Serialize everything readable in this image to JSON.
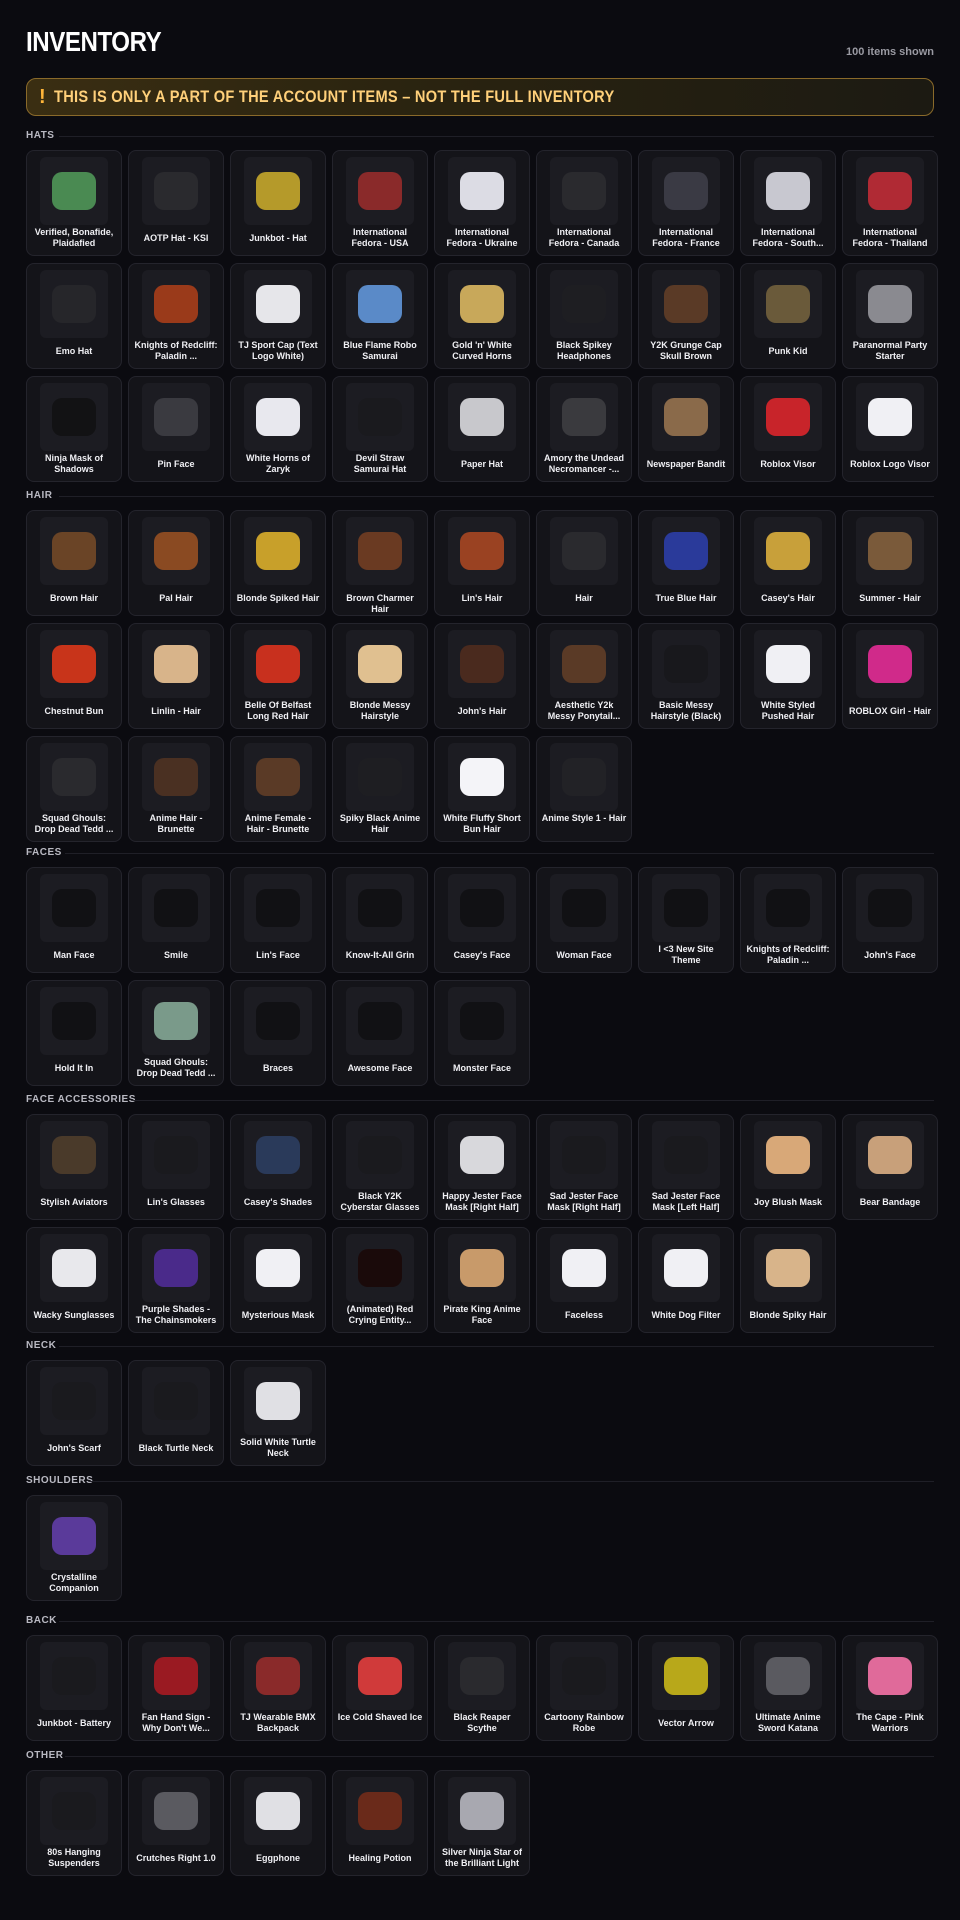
{
  "header": {
    "title": "INVENTORY",
    "count": "100 items shown"
  },
  "banner": {
    "icon": "!",
    "message": "THIS IS ONLY A PART OF THE ACCOUNT ITEMS – NOT THE FULL INVENTORY"
  },
  "sections": [
    {
      "title": "HATS",
      "items": [
        {
          "name": "Verified, Bonafide, Plaidafied",
          "color": "#4a8a52"
        },
        {
          "name": "AOTP Hat - KSI",
          "color": "#2a2a2e"
        },
        {
          "name": "Junkbot - Hat",
          "color": "#b59a2a"
        },
        {
          "name": "International Fedora - USA",
          "color": "#8a2a2a"
        },
        {
          "name": "International Fedora - Ukraine",
          "color": "#dcdce4"
        },
        {
          "name": "International Fedora - Canada",
          "color": "#2a2a2e"
        },
        {
          "name": "International Fedora - France",
          "color": "#3a3a44"
        },
        {
          "name": "International Fedora - South...",
          "color": "#c8c8d0"
        },
        {
          "name": "International Fedora - Thailand",
          "color": "#b02a34"
        },
        {
          "name": "Emo Hat",
          "color": "#26262a"
        },
        {
          "name": "Knights of Redcliff: Paladin ...",
          "color": "#9a3a1a"
        },
        {
          "name": "TJ Sport Cap (Text Logo White)",
          "color": "#e6e6ea"
        },
        {
          "name": "Blue Flame Robo Samurai",
          "color": "#5a8ac8"
        },
        {
          "name": "Gold 'n' White Curved Horns",
          "color": "#c8a85a"
        },
        {
          "name": "Black Spikey Headphones",
          "color": "#1e1e22"
        },
        {
          "name": "Y2K Grunge Cap Skull Brown",
          "color": "#5a3a26"
        },
        {
          "name": "Punk Kid",
          "color": "#6a5a3a"
        },
        {
          "name": "Paranormal Party Starter",
          "color": "#8a8a90"
        },
        {
          "name": "Ninja Mask of Shadows",
          "color": "#121214"
        },
        {
          "name": "Pin Face",
          "color": "#3a3a40"
        },
        {
          "name": "White Horns of Zaryk",
          "color": "#e8e8ee"
        },
        {
          "name": "Devil Straw Samurai Hat",
          "color": "#1a1a1e"
        },
        {
          "name": "Paper Hat",
          "color": "#c8c8cc"
        },
        {
          "name": "Amory the Undead Necromancer -...",
          "color": "#3a3a3e"
        },
        {
          "name": "Newspaper Bandit",
          "color": "#8a6a4a"
        },
        {
          "name": "Roblox Visor",
          "color": "#c8242a"
        },
        {
          "name": "Roblox Logo Visor",
          "color": "#f0f0f4"
        }
      ]
    },
    {
      "title": "HAIR",
      "items": [
        {
          "name": "Brown Hair",
          "color": "#6a4426"
        },
        {
          "name": "Pal Hair",
          "color": "#8a4a22"
        },
        {
          "name": "Blonde Spiked Hair",
          "color": "#c8a02a"
        },
        {
          "name": "Brown Charmer Hair",
          "color": "#6a3a22"
        },
        {
          "name": "Lin's Hair",
          "color": "#9a4222"
        },
        {
          "name": "Hair",
          "color": "#2a2a2e"
        },
        {
          "name": "True Blue Hair",
          "color": "#2a3a9a"
        },
        {
          "name": "Casey's Hair",
          "color": "#c8a03a"
        },
        {
          "name": "Summer - Hair",
          "color": "#7a5a3a"
        },
        {
          "name": "Chestnut Bun",
          "color": "#c8341a"
        },
        {
          "name": "Linlin - Hair",
          "color": "#d8b48a"
        },
        {
          "name": "Belle Of Belfast Long Red Hair",
          "color": "#c8301e"
        },
        {
          "name": "Blonde Messy Hairstyle",
          "color": "#e0c090"
        },
        {
          "name": "John's Hair",
          "color": "#4a2a1e"
        },
        {
          "name": "Aesthetic Y2k Messy Ponytail...",
          "color": "#5a3a26"
        },
        {
          "name": "Basic Messy Hairstyle (Black)",
          "color": "#18181c"
        },
        {
          "name": "White Styled Pushed Hair",
          "color": "#f0f0f4"
        },
        {
          "name": "ROBLOX Girl - Hair",
          "color": "#d02a8a"
        },
        {
          "name": "Squad Ghouls: Drop Dead Tedd ...",
          "color": "#2a2a2e"
        },
        {
          "name": "Anime Hair - Brunette",
          "color": "#4a3022"
        },
        {
          "name": "Anime Female - Hair - Brunette",
          "color": "#5a3a26"
        },
        {
          "name": "Spiky Black Anime Hair",
          "color": "#1e1e22"
        },
        {
          "name": "White Fluffy Short Bun Hair",
          "color": "#f4f4f8"
        },
        {
          "name": "Anime Style 1 - Hair",
          "color": "#222226"
        }
      ]
    },
    {
      "title": "FACES",
      "items": [
        {
          "name": "Man Face",
          "color": "#111114"
        },
        {
          "name": "Smile",
          "color": "#111114"
        },
        {
          "name": "Lin's Face",
          "color": "#111114"
        },
        {
          "name": "Know-It-All Grin",
          "color": "#111114"
        },
        {
          "name": "Casey's Face",
          "color": "#111114"
        },
        {
          "name": "Woman Face",
          "color": "#111114"
        },
        {
          "name": "I <3 New Site Theme",
          "color": "#111114"
        },
        {
          "name": "Knights of Redcliff: Paladin ...",
          "color": "#111114"
        },
        {
          "name": "John's Face",
          "color": "#111114"
        },
        {
          "name": "Hold It In",
          "color": "#111114"
        },
        {
          "name": "Squad Ghouls: Drop Dead Tedd ...",
          "color": "#7a9a8a"
        },
        {
          "name": "Braces",
          "color": "#111114"
        },
        {
          "name": "Awesome Face",
          "color": "#111114"
        },
        {
          "name": "Monster Face",
          "color": "#111114"
        }
      ]
    },
    {
      "title": "FACE ACCESSORIES",
      "items": [
        {
          "name": "Stylish Aviators",
          "color": "#4a3a2a"
        },
        {
          "name": "Lin's Glasses",
          "color": "#1a1a1e"
        },
        {
          "name": "Casey's Shades",
          "color": "#2a3a5a"
        },
        {
          "name": "Black Y2K Cyberstar Glasses",
          "color": "#1a1a1e"
        },
        {
          "name": "Happy Jester Face Mask [Right Half]",
          "color": "#d8d8dc"
        },
        {
          "name": "Sad Jester Face Mask [Right Half]",
          "color": "#1a1a1e"
        },
        {
          "name": "Sad Jester Face Mask [Left Half]",
          "color": "#1a1a1e"
        },
        {
          "name": "Joy Blush Mask",
          "color": "#d8a878"
        },
        {
          "name": "Bear Bandage",
          "color": "#c8a07a"
        },
        {
          "name": "Wacky Sunglasses",
          "color": "#e8e8ec"
        },
        {
          "name": "Purple Shades - The Chainsmokers",
          "color": "#4a2a8a"
        },
        {
          "name": "Mysterious Mask",
          "color": "#f0f0f4"
        },
        {
          "name": "(Animated) Red Crying Entity...",
          "color": "#1a0a0a"
        },
        {
          "name": "Pirate King Anime Face",
          "color": "#c89a6a"
        },
        {
          "name": "Faceless",
          "color": "#f0f0f4"
        },
        {
          "name": "White Dog Filter",
          "color": "#f0f0f4"
        },
        {
          "name": "Blonde Spiky Hair",
          "color": "#d8b48a"
        }
      ]
    },
    {
      "title": "NECK",
      "items": [
        {
          "name": "John's Scarf",
          "color": "#1a1a1e"
        },
        {
          "name": "Black Turtle Neck",
          "color": "#1a1a1e"
        },
        {
          "name": "Solid White Turtle Neck",
          "color": "#e0e0e4"
        }
      ]
    },
    {
      "title": "SHOULDERS",
      "items": [
        {
          "name": "Crystalline Companion",
          "color": "#5a3a9a"
        }
      ]
    },
    {
      "title": "BACK",
      "items": [
        {
          "name": "Junkbot - Battery",
          "color": "#1a1a1e"
        },
        {
          "name": "Fan Hand Sign - Why Don't We...",
          "color": "#9a1a22"
        },
        {
          "name": "TJ Wearable BMX Backpack",
          "color": "#8a2a2a"
        },
        {
          "name": "Ice Cold Shaved Ice",
          "color": "#d03a3a"
        },
        {
          "name": "Black Reaper Scythe",
          "color": "#2a2a2e"
        },
        {
          "name": "Cartoony Rainbow Robe",
          "color": "#1a1a1e"
        },
        {
          "name": "Vector Arrow",
          "color": "#b8a81a"
        },
        {
          "name": "Ultimate Anime Sword Katana",
          "color": "#5a5a60"
        },
        {
          "name": "The Cape - Pink Warriors",
          "color": "#e06a9a"
        }
      ]
    },
    {
      "title": "OTHER",
      "items": [
        {
          "name": "80s Hanging Suspenders",
          "color": "#1a1a1e"
        },
        {
          "name": "Crutches Right 1.0",
          "color": "#5a5a60"
        },
        {
          "name": "Eggphone",
          "color": "#e0e0e4"
        },
        {
          "name": "Healing Potion",
          "color": "#6a2a1a"
        },
        {
          "name": "Silver Ninja Star of the Brilliant Light",
          "color": "#a8a8b0"
        }
      ]
    }
  ]
}
